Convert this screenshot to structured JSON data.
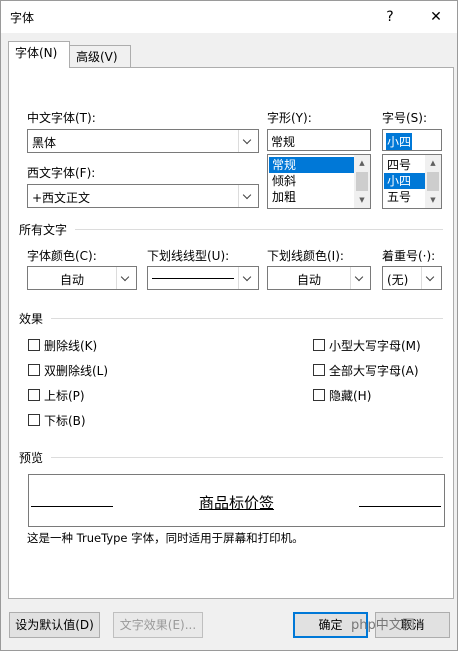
{
  "window": {
    "title": "字体",
    "help_label": "?",
    "close_label": "✕"
  },
  "tabs": [
    {
      "label": "字体(N)",
      "active": true
    },
    {
      "label": "高级(V)",
      "active": false
    }
  ],
  "fields": {
    "chinese_font_label": "中文字体(T):",
    "chinese_font_value": "黑体",
    "western_font_label": "西文字体(F):",
    "western_font_value": "+西文正文",
    "style_label": "字形(Y):",
    "style_value": "常规",
    "style_options": [
      "常规",
      "倾斜",
      "加粗"
    ],
    "size_label": "字号(S):",
    "size_value": "小四",
    "size_options": [
      "四号",
      "小四",
      "五号"
    ]
  },
  "all_text": {
    "section_label": "所有文字",
    "font_color_label": "字体颜色(C):",
    "font_color_value": "自动",
    "underline_style_label": "下划线线型(U):",
    "underline_color_label": "下划线颜色(I):",
    "underline_color_value": "自动",
    "emphasis_label": "着重号(·):",
    "emphasis_value": "(无)"
  },
  "effects": {
    "section_label": "效果",
    "left": [
      "删除线(K)",
      "双删除线(L)",
      "上标(P)",
      "下标(B)"
    ],
    "right": [
      "小型大写字母(M)",
      "全部大写字母(A)",
      "隐藏(H)"
    ]
  },
  "preview": {
    "section_label": "预览",
    "sample_text": "商品标价签",
    "note": "这是一种 TrueType 字体，同时适用于屏幕和打印机。"
  },
  "buttons": {
    "set_default": "设为默认值(D)",
    "text_effects": "文字效果(E)...",
    "ok": "确定",
    "cancel": "取消"
  },
  "watermark": "php中文网"
}
